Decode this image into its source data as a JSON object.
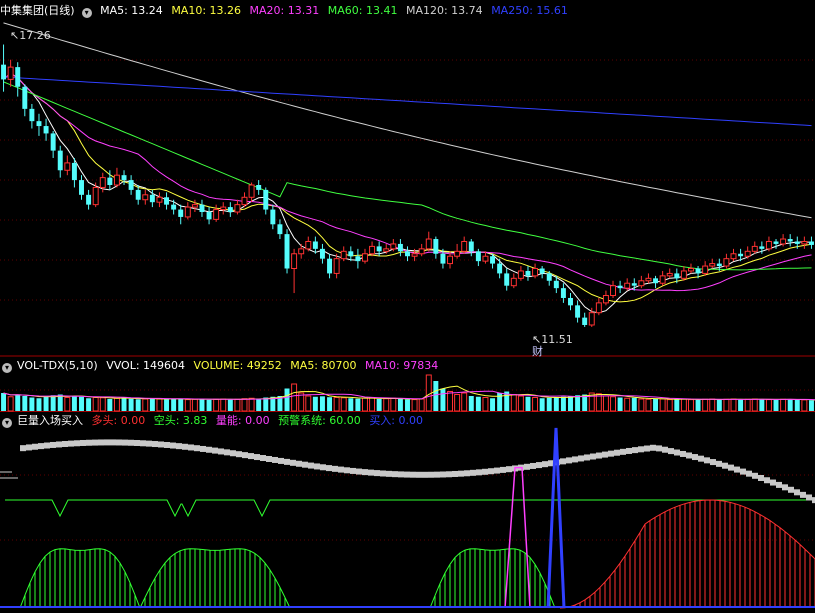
{
  "chart_data": [
    {
      "type": "candlestick",
      "title": "中集集团(日线)",
      "legend": [
        {
          "label": "MA5: 13.24",
          "color": "#ffffff"
        },
        {
          "label": "MA10: 13.26",
          "color": "#ffff40"
        },
        {
          "label": "MA20: 13.31",
          "color": "#ff40ff"
        },
        {
          "label": "MA60: 13.41",
          "color": "#40ff40"
        },
        {
          "label": "MA120: 13.74",
          "color": "#d0d0d0"
        },
        {
          "label": "MA250: 15.61",
          "color": "#3040ff"
        }
      ],
      "high_label": "17.26",
      "low_label": "11.51",
      "low_marker": "财",
      "ylim": [
        11.0,
        17.8
      ],
      "candles": [
        [
          16.85,
          16.55,
          17.26,
          16.3
        ],
        [
          16.55,
          16.8,
          16.95,
          16.4
        ],
        [
          16.8,
          16.4,
          16.9,
          16.2
        ],
        [
          16.4,
          15.95,
          16.45,
          15.8
        ],
        [
          15.95,
          15.7,
          16.05,
          15.55
        ],
        [
          15.7,
          15.6,
          15.85,
          15.4
        ],
        [
          15.6,
          15.45,
          15.75,
          15.3
        ],
        [
          15.45,
          15.1,
          15.5,
          14.95
        ],
        [
          15.1,
          14.7,
          15.2,
          14.55
        ],
        [
          14.7,
          14.85,
          15.0,
          14.6
        ],
        [
          14.85,
          14.5,
          14.95,
          14.35
        ],
        [
          14.5,
          14.2,
          14.6,
          14.1
        ],
        [
          14.2,
          14.0,
          14.3,
          13.9
        ],
        [
          14.0,
          14.35,
          14.45,
          13.95
        ],
        [
          14.35,
          14.55,
          14.65,
          14.25
        ],
        [
          14.55,
          14.4,
          14.7,
          14.3
        ],
        [
          14.4,
          14.6,
          14.75,
          14.35
        ],
        [
          14.6,
          14.5,
          14.7,
          14.4
        ],
        [
          14.5,
          14.3,
          14.6,
          14.2
        ],
        [
          14.3,
          14.1,
          14.4,
          14.0
        ],
        [
          14.1,
          14.2,
          14.3,
          14.0
        ],
        [
          14.2,
          14.05,
          14.3,
          13.95
        ],
        [
          14.05,
          14.15,
          14.25,
          13.95
        ],
        [
          14.15,
          14.0,
          14.25,
          13.9
        ],
        [
          14.0,
          13.9,
          14.1,
          13.8
        ],
        [
          13.9,
          13.75,
          14.0,
          13.6
        ],
        [
          13.75,
          13.95,
          14.05,
          13.7
        ],
        [
          13.95,
          14.0,
          14.1,
          13.85
        ],
        [
          14.0,
          13.85,
          14.1,
          13.75
        ],
        [
          13.85,
          13.7,
          13.95,
          13.6
        ],
        [
          13.7,
          13.9,
          14.0,
          13.65
        ],
        [
          13.9,
          13.95,
          14.05,
          13.8
        ],
        [
          13.95,
          13.85,
          14.05,
          13.75
        ],
        [
          13.85,
          14.0,
          14.1,
          13.8
        ],
        [
          14.0,
          14.15,
          14.25,
          13.95
        ],
        [
          14.15,
          14.4,
          14.45,
          14.05
        ],
        [
          14.4,
          14.3,
          14.5,
          14.2
        ],
        [
          14.3,
          13.9,
          14.35,
          13.8
        ],
        [
          13.9,
          13.6,
          14.0,
          13.5
        ],
        [
          13.6,
          13.4,
          13.7,
          13.3
        ],
        [
          13.4,
          12.7,
          13.5,
          12.6
        ],
        [
          12.7,
          13.0,
          13.1,
          12.2
        ],
        [
          13.0,
          13.1,
          13.2,
          12.9
        ],
        [
          13.1,
          13.25,
          13.35,
          13.05
        ],
        [
          13.25,
          13.1,
          13.35,
          13.0
        ],
        [
          13.1,
          12.9,
          13.2,
          12.8
        ],
        [
          12.9,
          12.6,
          13.0,
          12.5
        ],
        [
          12.6,
          12.9,
          13.0,
          12.5
        ],
        [
          12.9,
          13.05,
          13.15,
          12.85
        ],
        [
          13.05,
          12.95,
          13.15,
          12.85
        ],
        [
          12.95,
          12.85,
          13.1,
          12.7
        ],
        [
          12.85,
          13.0,
          13.1,
          12.8
        ],
        [
          13.0,
          13.15,
          13.25,
          12.95
        ],
        [
          13.15,
          13.05,
          13.25,
          12.95
        ],
        [
          13.05,
          13.1,
          13.2,
          13.0
        ],
        [
          13.1,
          13.2,
          13.3,
          13.05
        ],
        [
          13.2,
          13.05,
          13.3,
          12.95
        ],
        [
          13.05,
          12.95,
          13.15,
          12.85
        ],
        [
          12.95,
          13.0,
          13.1,
          12.85
        ],
        [
          13.0,
          13.1,
          13.2,
          12.95
        ],
        [
          13.1,
          13.3,
          13.45,
          13.05
        ],
        [
          13.3,
          13.0,
          13.35,
          12.9
        ],
        [
          13.0,
          12.8,
          13.1,
          12.7
        ],
        [
          12.8,
          12.95,
          13.05,
          12.7
        ],
        [
          12.95,
          13.05,
          13.2,
          12.9
        ],
        [
          13.05,
          13.25,
          13.35,
          13.0
        ],
        [
          13.25,
          13.05,
          13.3,
          12.95
        ],
        [
          13.05,
          12.85,
          13.1,
          12.75
        ],
        [
          12.85,
          12.95,
          13.05,
          12.8
        ],
        [
          12.95,
          12.8,
          13.0,
          12.7
        ],
        [
          12.8,
          12.6,
          12.9,
          12.5
        ],
        [
          12.6,
          12.35,
          12.7,
          12.25
        ],
        [
          12.35,
          12.5,
          12.6,
          12.3
        ],
        [
          12.5,
          12.65,
          12.75,
          12.45
        ],
        [
          12.65,
          12.55,
          12.75,
          12.45
        ],
        [
          12.55,
          12.7,
          12.8,
          12.5
        ],
        [
          12.7,
          12.6,
          12.75,
          12.5
        ],
        [
          12.6,
          12.45,
          12.65,
          12.35
        ],
        [
          12.45,
          12.3,
          12.55,
          12.2
        ],
        [
          12.3,
          12.1,
          12.4,
          12.0
        ],
        [
          12.1,
          11.95,
          12.2,
          11.85
        ],
        [
          11.95,
          11.7,
          12.05,
          11.6
        ],
        [
          11.7,
          11.55,
          11.8,
          11.51
        ],
        [
          11.55,
          11.8,
          11.9,
          11.51
        ],
        [
          11.8,
          12.0,
          12.1,
          11.75
        ],
        [
          12.0,
          12.15,
          12.25,
          11.95
        ],
        [
          12.15,
          12.35,
          12.45,
          12.1
        ],
        [
          12.35,
          12.3,
          12.45,
          12.2
        ],
        [
          12.3,
          12.4,
          12.5,
          12.25
        ],
        [
          12.4,
          12.35,
          12.5,
          12.25
        ],
        [
          12.35,
          12.45,
          12.55,
          12.3
        ],
        [
          12.45,
          12.5,
          12.6,
          12.4
        ],
        [
          12.5,
          12.4,
          12.55,
          12.3
        ],
        [
          12.4,
          12.55,
          12.65,
          12.35
        ],
        [
          12.55,
          12.6,
          12.7,
          12.5
        ],
        [
          12.6,
          12.5,
          12.7,
          12.4
        ],
        [
          12.5,
          12.65,
          12.75,
          12.45
        ],
        [
          12.65,
          12.7,
          12.8,
          12.6
        ],
        [
          12.7,
          12.6,
          12.75,
          12.5
        ],
        [
          12.6,
          12.75,
          12.85,
          12.55
        ],
        [
          12.75,
          12.8,
          12.9,
          12.7
        ],
        [
          12.8,
          12.75,
          12.9,
          12.65
        ],
        [
          12.75,
          12.9,
          13.0,
          12.7
        ],
        [
          12.9,
          13.0,
          13.1,
          12.85
        ],
        [
          13.0,
          12.95,
          13.1,
          12.85
        ],
        [
          12.95,
          13.05,
          13.15,
          12.9
        ],
        [
          13.05,
          13.15,
          13.25,
          13.0
        ],
        [
          13.15,
          13.1,
          13.25,
          13.0
        ],
        [
          13.1,
          13.25,
          13.35,
          13.05
        ],
        [
          13.25,
          13.2,
          13.3,
          13.1
        ],
        [
          13.2,
          13.3,
          13.4,
          13.15
        ],
        [
          13.3,
          13.25,
          13.4,
          13.15
        ],
        [
          13.25,
          13.2,
          13.35,
          13.1
        ],
        [
          13.2,
          13.25,
          13.35,
          13.1
        ],
        [
          13.25,
          13.18,
          13.35,
          13.1
        ]
      ],
      "ma_series": [
        {
          "name": "MA5",
          "color": "#ffffff"
        },
        {
          "name": "MA10",
          "color": "#ffff40"
        },
        {
          "name": "MA20",
          "color": "#ff40ff"
        },
        {
          "name": "MA60",
          "color": "#40ff40"
        },
        {
          "name": "MA120",
          "color": "#d0d0d0"
        },
        {
          "name": "MA250",
          "color": "#3040ff"
        }
      ]
    },
    {
      "type": "bar",
      "title": "VOL-TDX(5,10)",
      "legend": [
        {
          "label": "VVOL: 149604",
          "color": "#ffffff"
        },
        {
          "label": "VOLUME: 49252",
          "color": "#ffff40"
        },
        {
          "label": "MA5: 80700",
          "color": "#ffff40"
        },
        {
          "label": "MA10: 97834",
          "color": "#ff40ff"
        }
      ],
      "ylim": [
        0,
        260000
      ],
      "volumes": [
        120000,
        95000,
        110000,
        100000,
        90000,
        85000,
        95000,
        105000,
        110000,
        90000,
        100000,
        95000,
        85000,
        90000,
        88000,
        80000,
        85000,
        90000,
        82000,
        78000,
        80000,
        85000,
        80000,
        78000,
        82000,
        80000,
        76000,
        78000,
        80000,
        75000,
        78000,
        80000,
        76000,
        78000,
        82000,
        85000,
        80000,
        90000,
        95000,
        100000,
        150000,
        180000,
        120000,
        100000,
        95000,
        98000,
        92000,
        90000,
        88000,
        85000,
        82000,
        86000,
        88000,
        80000,
        82000,
        85000,
        80000,
        78000,
        76000,
        80000,
        240000,
        200000,
        150000,
        130000,
        110000,
        120000,
        100000,
        95000,
        90000,
        85000,
        120000,
        130000,
        110000,
        100000,
        95000,
        90000,
        85000,
        88000,
        92000,
        95000,
        100000,
        105000,
        110000,
        120000,
        115000,
        100000,
        95000,
        90000,
        85000,
        88000,
        80000,
        78000,
        82000,
        80000,
        76000,
        78000,
        80000,
        76000,
        74000,
        78000,
        80000,
        76000,
        78000,
        80000,
        76000,
        78000,
        80000,
        78000,
        76000,
        74000,
        78000,
        80000,
        76000,
        74000,
        72000,
        49252
      ],
      "ma5": [],
      "ma10": []
    },
    {
      "type": "line",
      "title": "巨量入场买入",
      "legend": [
        {
          "label": "多头: 0.00",
          "color": "#ff3030"
        },
        {
          "label": "空头: 3.83",
          "color": "#30ff30"
        },
        {
          "label": "量能: 0.00",
          "color": "#ff40ff"
        },
        {
          "label": "预警系统: 60.00",
          "color": "#30ff30"
        },
        {
          "label": "买入: 0.00",
          "color": "#3040ff"
        }
      ],
      "ylim": [
        0,
        100
      ],
      "warning_level": 60
    }
  ]
}
